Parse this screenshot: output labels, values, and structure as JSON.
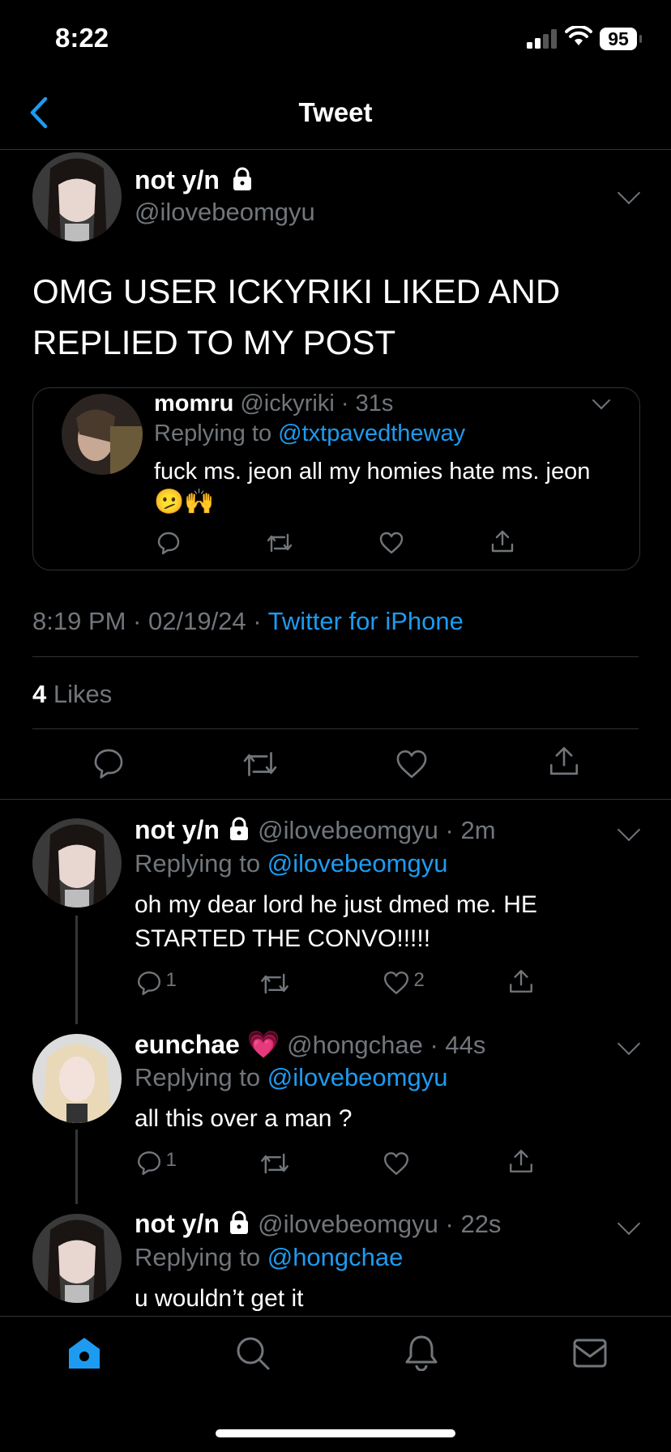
{
  "status_bar": {
    "time": "8:22",
    "battery": "95"
  },
  "nav": {
    "title": "Tweet"
  },
  "main_tweet": {
    "name": "not y/n",
    "handle": "@ilovebeomgyu",
    "text_line1": "OMG USER ICKYRIKI LIKED AND",
    "text_line2": "REPLIED TO MY POST",
    "quote": {
      "name": "momru",
      "handle": "@ickyriki",
      "time": "31s",
      "replying_prefix": "Replying to",
      "replying_to": "@txtpavedtheway",
      "text": "fuck ms. jeon all my homies hate ms. jeon",
      "emojis": "🫤🙌"
    },
    "timestamp": "8:19 PM · 02/19/24 · ",
    "source": "Twitter for iPhone",
    "likes_count": "4",
    "likes_label": "Likes"
  },
  "replies": [
    {
      "name": "not y/n",
      "handle": "@ilovebeomgyu",
      "time": "2m",
      "replying_prefix": "Replying to",
      "replying_to": "@ilovebeomgyu",
      "text_line1": "oh my dear lord he just dmed me. HE",
      "text_line2": "STARTED THE CONVO!!!!!",
      "reply_count": "1",
      "like_count": "2"
    },
    {
      "name": "eunchae",
      "name_emoji": "💗",
      "handle": "@hongchae",
      "time": "44s",
      "replying_prefix": "Replying to",
      "replying_to": "@ilovebeomgyu",
      "text_line1": "all this over a man ?",
      "reply_count": "1"
    },
    {
      "name": "not y/n",
      "handle": "@ilovebeomgyu",
      "time": "22s",
      "replying_prefix": "Replying to",
      "replying_to": "@hongchae",
      "text_line1": "u wouldn’t get it"
    }
  ],
  "colors": {
    "accent": "#1d9bf0",
    "muted": "#71767b",
    "divider": "#2f3336"
  },
  "tabbar": {
    "items": [
      "home-icon",
      "search-icon",
      "bell-icon",
      "mail-icon"
    ]
  }
}
